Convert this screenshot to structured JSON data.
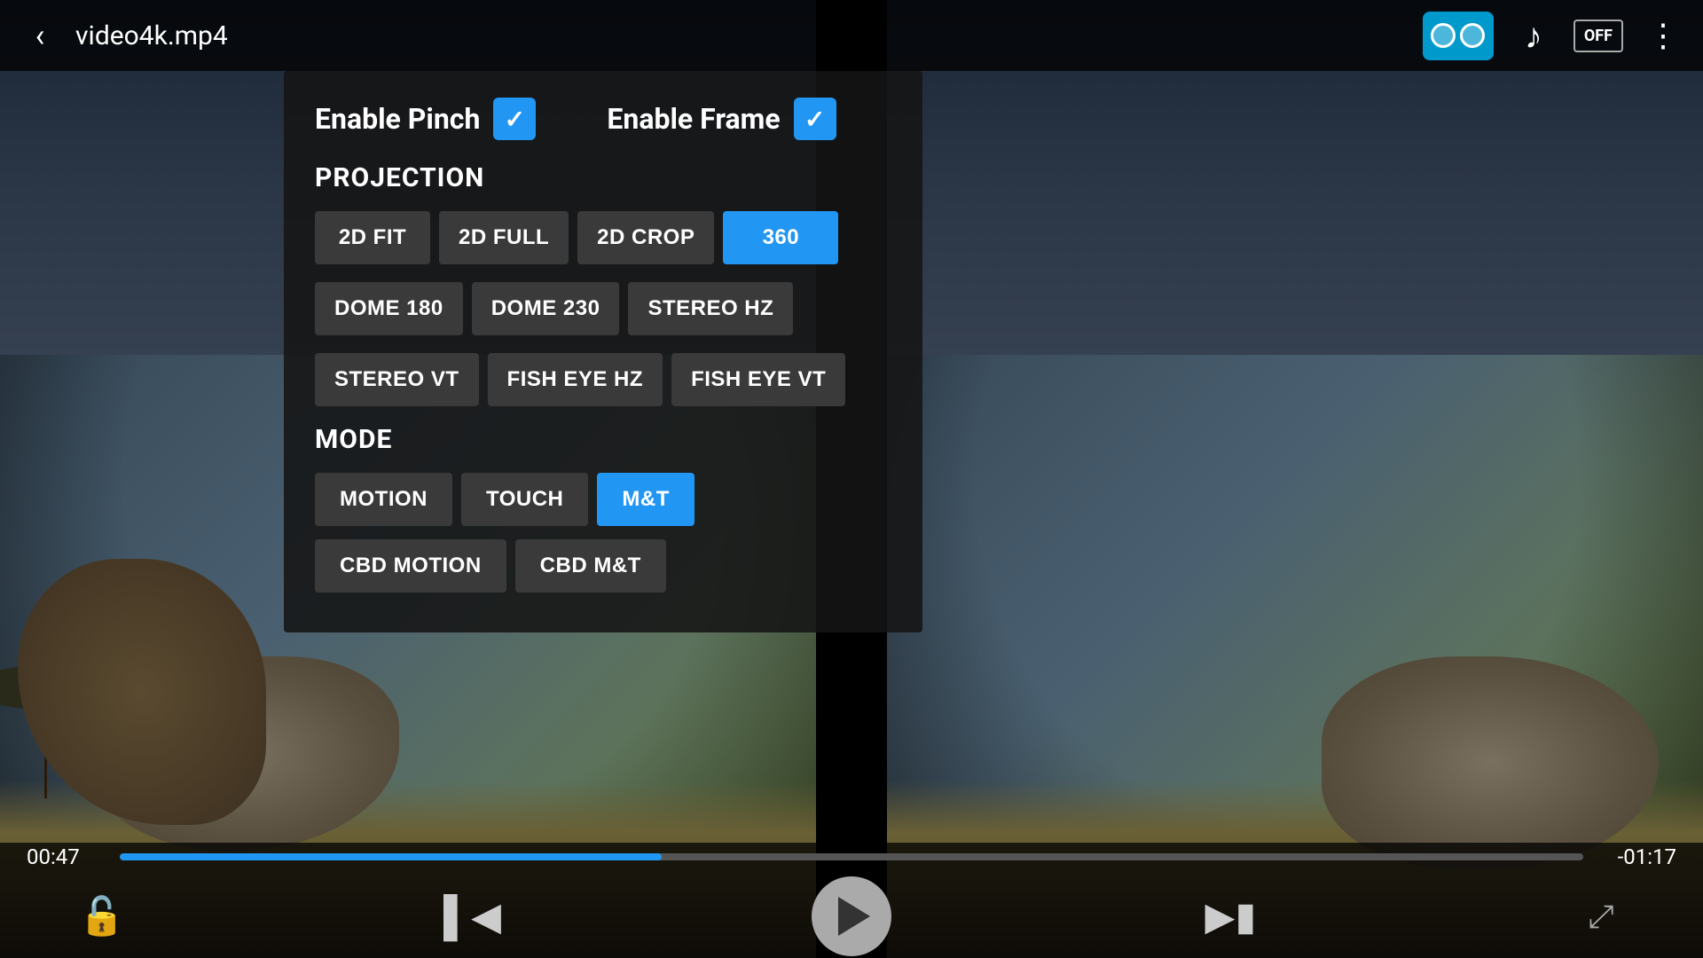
{
  "header": {
    "back_label": "‹",
    "title": "video4k.mp4"
  },
  "topbar": {
    "vr_btn_label": "VR",
    "music_icon": "♪",
    "off_label": "OFF",
    "menu_icon": "⋮"
  },
  "settings": {
    "enable_pinch_label": "Enable Pinch",
    "enable_pinch_checked": true,
    "enable_frame_label": "Enable Frame",
    "enable_frame_checked": true,
    "projection_title": "PROJECTION",
    "projection_buttons": [
      {
        "label": "2D FIT",
        "active": false
      },
      {
        "label": "2D FULL",
        "active": false
      },
      {
        "label": "2D CROP",
        "active": false
      },
      {
        "label": "360",
        "active": true
      },
      {
        "label": "DOME 180",
        "active": false
      },
      {
        "label": "DOME 230",
        "active": false
      },
      {
        "label": "STEREO HZ",
        "active": false
      },
      {
        "label": "STEREO VT",
        "active": false
      },
      {
        "label": "FISH EYE HZ",
        "active": false
      },
      {
        "label": "FISH EYE VT",
        "active": false
      }
    ],
    "mode_title": "MODE",
    "mode_buttons": [
      {
        "label": "MOTION",
        "active": false
      },
      {
        "label": "TOUCH",
        "active": false
      },
      {
        "label": "M&T",
        "active": true
      }
    ],
    "mode_buttons2": [
      {
        "label": "CBD MOTION",
        "active": false
      },
      {
        "label": "CBD M&T",
        "active": false
      }
    ]
  },
  "playback": {
    "time_current": "00:47",
    "time_remaining": "-01:17",
    "progress_percent": 37
  },
  "colors": {
    "active_blue": "#2196f3",
    "inactive_btn": "#3a3a3a",
    "bg_overlay": "rgba(20,20,20,0.88)"
  }
}
